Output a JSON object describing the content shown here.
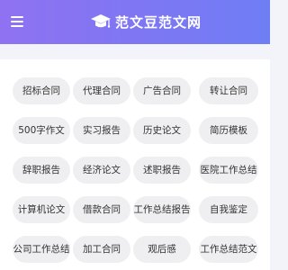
{
  "header": {
    "site_title": "范文豆范文网",
    "menu_icon": "hamburger-menu-icon",
    "logo_icon": "graduation-cap-icon",
    "background_colors": [
      "#8f72f2",
      "#6f7ef4"
    ]
  },
  "categories": [
    "招标合同",
    "代理合同",
    "广告合同",
    "转让合同",
    "500字作文",
    "实习报告",
    "历史论文",
    "简历模板",
    "辞职报告",
    "经济论文",
    "述职报告",
    "医院工作总结",
    "计算机论文",
    "借款合同",
    "工作总结报告",
    "自我鉴定",
    "公司工作总结",
    "加工合同",
    "观后感",
    "工作总结范文"
  ]
}
